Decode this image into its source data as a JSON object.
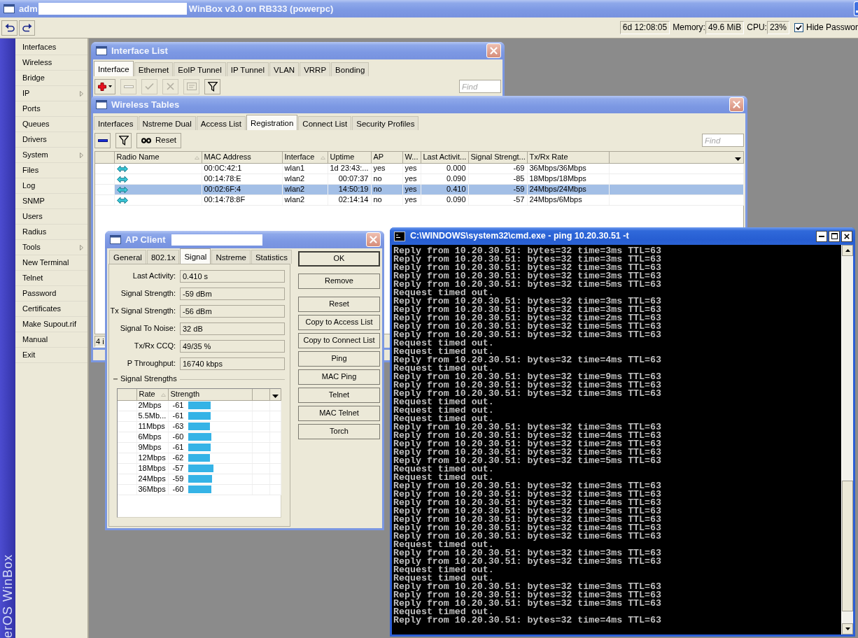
{
  "window": {
    "title_start": "adm",
    "title_redacted": true,
    "title_end": "WinBox v3.0 on RB333 (powerpc)"
  },
  "toolbar": {
    "uptime": "6d 12:08:05",
    "memory_label": "Memory:",
    "memory": "49.6 MiB",
    "cpu_label": "CPU:",
    "cpu": "23%",
    "hide_passwords": {
      "label": "Hide Passwor",
      "checked": true
    }
  },
  "sidebar": {
    "brand": "erOS WinBox",
    "items": [
      {
        "label": "Interfaces",
        "submenu": false
      },
      {
        "label": "Wireless",
        "submenu": false
      },
      {
        "label": "Bridge",
        "submenu": false
      },
      {
        "label": "IP",
        "submenu": true
      },
      {
        "label": "Ports",
        "submenu": false
      },
      {
        "label": "Queues",
        "submenu": false
      },
      {
        "label": "Drivers",
        "submenu": false
      },
      {
        "label": "System",
        "submenu": true
      },
      {
        "label": "Files",
        "submenu": false
      },
      {
        "label": "Log",
        "submenu": false
      },
      {
        "label": "SNMP",
        "submenu": false
      },
      {
        "label": "Users",
        "submenu": false
      },
      {
        "label": "Radius",
        "submenu": false
      },
      {
        "label": "Tools",
        "submenu": true
      },
      {
        "label": "New Terminal",
        "submenu": false
      },
      {
        "label": "Telnet",
        "submenu": false
      },
      {
        "label": "Password",
        "submenu": false
      },
      {
        "label": "Certificates",
        "submenu": false
      },
      {
        "label": "Make Supout.rif",
        "submenu": false
      },
      {
        "label": "Manual",
        "submenu": false
      },
      {
        "label": "Exit",
        "submenu": false
      }
    ]
  },
  "interface_list": {
    "title": "Interface List",
    "tabs": [
      {
        "label": "Interface",
        "selected": true
      },
      {
        "label": "Ethernet",
        "selected": false
      },
      {
        "label": "EoIP Tunnel",
        "selected": false
      },
      {
        "label": "IP Tunnel",
        "selected": false
      },
      {
        "label": "VLAN",
        "selected": false
      },
      {
        "label": "VRRP",
        "selected": false
      },
      {
        "label": "Bonding",
        "selected": false
      }
    ],
    "tools": [
      {
        "kind": "add",
        "disabled": false
      },
      {
        "kind": "remove",
        "disabled": true
      },
      {
        "kind": "enable",
        "disabled": true
      },
      {
        "kind": "disable",
        "disabled": true
      },
      {
        "kind": "comment",
        "disabled": true
      },
      {
        "kind": "filter",
        "disabled": false
      }
    ],
    "find": {
      "placeholder": "Find"
    }
  },
  "wireless_tables": {
    "title": "Wireless Tables",
    "tabs": [
      {
        "label": "Interfaces",
        "selected": false
      },
      {
        "label": "Nstreme Dual",
        "selected": false
      },
      {
        "label": "Access List",
        "selected": false
      },
      {
        "label": "Registration",
        "selected": true
      },
      {
        "label": "Connect List",
        "selected": false
      },
      {
        "label": "Security Profiles",
        "selected": false
      }
    ],
    "tools": [
      {
        "kind": "remove",
        "disabled": false
      },
      {
        "kind": "filter",
        "disabled": false
      },
      {
        "kind": "reset",
        "label": "Reset",
        "disabled": false
      }
    ],
    "find": {
      "placeholder": "Find"
    },
    "columns": [
      {
        "label": "Radio Name",
        "sorted": true
      },
      {
        "label": "MAC Address",
        "sorted": false
      },
      {
        "label": "Interface",
        "sorted": true
      },
      {
        "label": "Uptime",
        "sorted": false
      },
      {
        "label": "AP",
        "sorted": false
      },
      {
        "label": "W...",
        "sorted": false
      },
      {
        "label": "Last Activit...",
        "sorted": false
      },
      {
        "label": "Signal Strengt...",
        "sorted": false
      },
      {
        "label": "Tx/Rx Rate",
        "sorted": false
      }
    ],
    "rows": [
      {
        "cells": [
          "",
          "00:0C:42:1",
          "wlan1",
          "1d 23:43:...",
          "yes",
          "yes",
          "0.000",
          "-69",
          "36Mbps/36Mbps"
        ],
        "selected": false
      },
      {
        "cells": [
          "",
          "00:14:78:E",
          "wlan2",
          "00:07:37",
          "no",
          "yes",
          "0.090",
          "-85",
          "18Mbps/18Mbps"
        ],
        "selected": false
      },
      {
        "cells": [
          "",
          "00:02:6F:4",
          "wlan2",
          "14:50:19",
          "no",
          "yes",
          "0.410",
          "-59",
          "24Mbps/24Mbps"
        ],
        "selected": true
      },
      {
        "cells": [
          "",
          "00:14:78:8F",
          "wlan2",
          "02:14:14",
          "no",
          "yes",
          "0.090",
          "-57",
          "24Mbps/6Mbps"
        ],
        "selected": false
      }
    ],
    "status": "4 i"
  },
  "ap_client": {
    "title": "AP Client",
    "title_redacted": true,
    "tabs": [
      {
        "label": "General",
        "selected": false
      },
      {
        "label": "802.1x",
        "selected": false
      },
      {
        "label": "Signal",
        "selected": true
      },
      {
        "label": "Nstreme",
        "selected": false
      },
      {
        "label": "Statistics",
        "selected": false
      }
    ],
    "fields": [
      {
        "label": "Last Activity:",
        "value": "0.410 s"
      },
      {
        "label": "Signal Strength:",
        "value": "-59 dBm"
      },
      {
        "label": "Tx Signal Strength:",
        "value": "-56 dBm"
      },
      {
        "label": "Signal To Noise:",
        "value": "32 dB"
      },
      {
        "label": "Tx/Rx CCQ:",
        "value": "49/35 %"
      },
      {
        "label": "P Throughput:",
        "value": "16740 kbps"
      }
    ],
    "section": "Signal Strengths",
    "strength_table": {
      "columns": [
        {
          "label": "Rate",
          "sorted": true
        },
        {
          "label": "Strength",
          "sorted": false
        }
      ],
      "rows": [
        {
          "rate": "2Mbps",
          "strength": "-61",
          "level": 0.36
        },
        {
          "rate": "5.5Mb...",
          "strength": "-61",
          "level": 0.36
        },
        {
          "rate": "11Mbps",
          "strength": "-63",
          "level": 0.35
        },
        {
          "rate": "6Mbps",
          "strength": "-60",
          "level": 0.38
        },
        {
          "rate": "9Mbps",
          "strength": "-61",
          "level": 0.36
        },
        {
          "rate": "12Mbps",
          "strength": "-62",
          "level": 0.35
        },
        {
          "rate": "18Mbps",
          "strength": "-57",
          "level": 0.41
        },
        {
          "rate": "24Mbps",
          "strength": "-59",
          "level": 0.39
        },
        {
          "rate": "36Mbps",
          "strength": "-60",
          "level": 0.38
        }
      ]
    },
    "buttons": [
      {
        "label": "OK",
        "default": true
      },
      {
        "label": "Remove",
        "default": false
      },
      {
        "label": "Reset",
        "default": false
      },
      {
        "label": "Copy to Access List",
        "default": false
      },
      {
        "label": "Copy to Connect List",
        "default": false
      },
      {
        "label": "Ping",
        "default": false
      },
      {
        "label": "MAC Ping",
        "default": false
      },
      {
        "label": "Telnet",
        "default": false
      },
      {
        "label": "MAC Telnet",
        "default": false
      },
      {
        "label": "Torch",
        "default": false
      }
    ]
  },
  "console": {
    "title": "C:\\WINDOWS\\system32\\cmd.exe - ping 10.20.30.51 -t",
    "lines": [
      "Reply from 10.20.30.51: bytes=32 time=3ms TTL=63",
      "Reply from 10.20.30.51: bytes=32 time=3ms TTL=63",
      "Reply from 10.20.30.51: bytes=32 time=3ms TTL=63",
      "Reply from 10.20.30.51: bytes=32 time=3ms TTL=63",
      "Reply from 10.20.30.51: bytes=32 time=5ms TTL=63",
      "Request timed out.",
      "Reply from 10.20.30.51: bytes=32 time=3ms TTL=63",
      "Reply from 10.20.30.51: bytes=32 time=3ms TTL=63",
      "Reply from 10.20.30.51: bytes=32 time=2ms TTL=63",
      "Reply from 10.20.30.51: bytes=32 time=5ms TTL=63",
      "Reply from 10.20.30.51: bytes=32 time=3ms TTL=63",
      "Request timed out.",
      "Request timed out.",
      "Reply from 10.20.30.51: bytes=32 time=4ms TTL=63",
      "Request timed out.",
      "Reply from 10.20.30.51: bytes=32 time=9ms TTL=63",
      "Reply from 10.20.30.51: bytes=32 time=3ms TTL=63",
      "Reply from 10.20.30.51: bytes=32 time=3ms TTL=63",
      "Request timed out.",
      "Request timed out.",
      "Request timed out.",
      "Reply from 10.20.30.51: bytes=32 time=3ms TTL=63",
      "Reply from 10.20.30.51: bytes=32 time=4ms TTL=63",
      "Reply from 10.20.30.51: bytes=32 time=2ms TTL=63",
      "Reply from 10.20.30.51: bytes=32 time=3ms TTL=63",
      "Reply from 10.20.30.51: bytes=32 time=5ms TTL=63",
      "Request timed out.",
      "Request timed out.",
      "Reply from 10.20.30.51: bytes=32 time=3ms TTL=63",
      "Reply from 10.20.30.51: bytes=32 time=3ms TTL=63",
      "Reply from 10.20.30.51: bytes=32 time=4ms TTL=63",
      "Reply from 10.20.30.51: bytes=32 time=5ms TTL=63",
      "Reply from 10.20.30.51: bytes=32 time=3ms TTL=63",
      "Reply from 10.20.30.51: bytes=32 time=4ms TTL=63",
      "Reply from 10.20.30.51: bytes=32 time=6ms TTL=63",
      "Request timed out.",
      "Reply from 10.20.30.51: bytes=32 time=3ms TTL=63",
      "Reply from 10.20.30.51: bytes=32 time=3ms TTL=63",
      "Request timed out.",
      "Request timed out.",
      "Reply from 10.20.30.51: bytes=32 time=3ms TTL=63",
      "Reply from 10.20.30.51: bytes=32 time=3ms TTL=63",
      "Reply from 10.20.30.51: bytes=32 time=3ms TTL=63",
      "Request timed out.",
      "Reply from 10.20.30.51: bytes=32 time=4ms TTL=63"
    ]
  }
}
